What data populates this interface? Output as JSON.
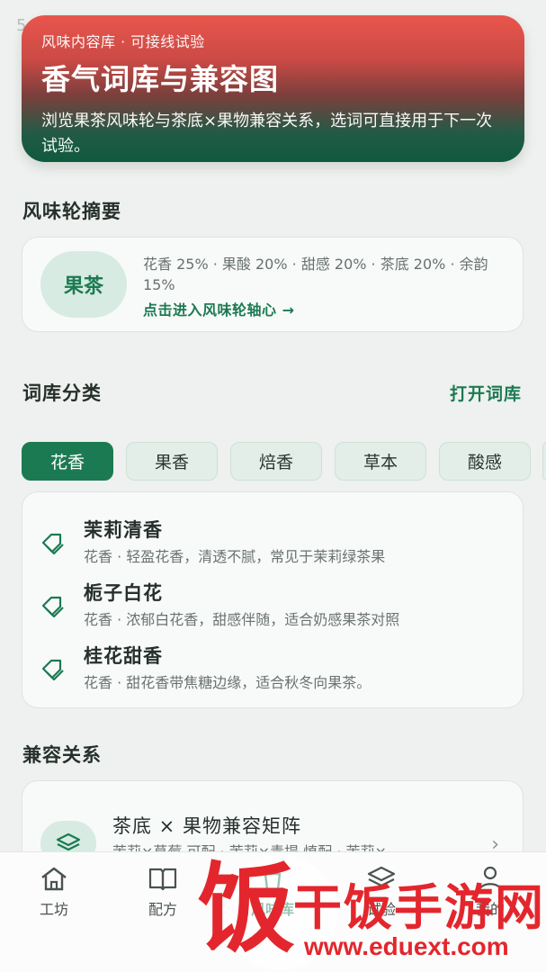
{
  "status_bar": {
    "time": "5"
  },
  "hero": {
    "eyebrow": "风味内容库 · 可接线试验",
    "title": "香气词库与兼容图",
    "description": "浏览果茶风味轮与茶底×果物兼容关系，选词可直接用于下一次试验。",
    "gradient_colors": [
      "#e8564d",
      "#0f5a3e"
    ]
  },
  "flavor_wheel": {
    "section_title": "风味轮摘要",
    "badge": "果茶",
    "summary": "花香 25% · 果酸 20% · 甜感 20% · 茶底 20% · 余韵 15%",
    "link": "点击进入风味轮轴心 →"
  },
  "lexicon": {
    "section_title": "词库分类",
    "open_link": "打开词库",
    "chips": [
      {
        "label": "花香",
        "active": true
      },
      {
        "label": "果香",
        "active": false
      },
      {
        "label": "焙香",
        "active": false
      },
      {
        "label": "草本",
        "active": false
      },
      {
        "label": "酸感",
        "active": false
      }
    ],
    "items": [
      {
        "name": "茉莉清香",
        "description": "花香 · 轻盈花香，清透不腻，常见于茉莉绿茶果",
        "icon": "tag-icon"
      },
      {
        "name": "栀子白花",
        "description": "花香 · 浓郁白花香，甜感伴随，适合奶感果茶对照",
        "icon": "tag-icon"
      },
      {
        "name": "桂花甜香",
        "description": "花香 · 甜花香带焦糖边缘，适合秋冬向果茶。",
        "icon": "tag-icon"
      }
    ]
  },
  "compatibility": {
    "section_title": "兼容关系",
    "card_title": "茶底 × 果物兼容矩阵",
    "card_subtitle": "茉莉×草莓 可配 · 茉莉×青提 慎配 · 茉莉×",
    "icon": "layers-icon"
  },
  "tabbar": {
    "tabs": [
      {
        "label": "工坊",
        "icon": "home-icon",
        "active": false
      },
      {
        "label": "配方",
        "icon": "book-icon",
        "active": false
      },
      {
        "label": "风味库",
        "icon": "cup-icon",
        "active": true
      },
      {
        "label": "试验",
        "icon": "layers-icon",
        "active": false
      },
      {
        "label": "我的",
        "icon": "person-icon",
        "active": false
      }
    ],
    "active_color": "#1c7a52"
  },
  "watermark": {
    "glyph": "饭",
    "text": "干饭手游网",
    "url": "www.eduext.com"
  }
}
